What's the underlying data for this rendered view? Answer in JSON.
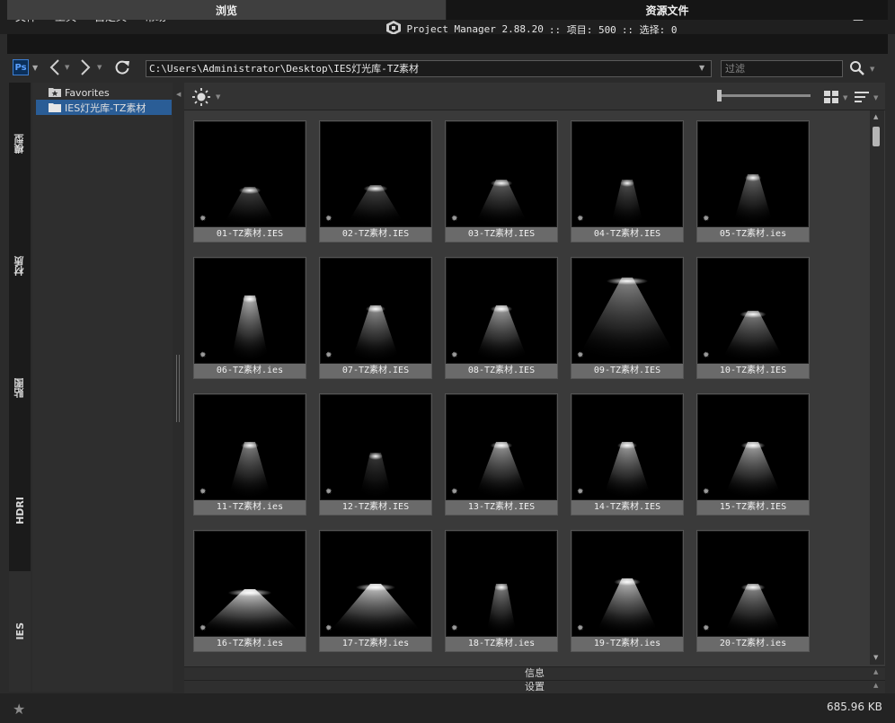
{
  "menu": [
    "文件",
    "工具",
    "自定义",
    "帮助"
  ],
  "title": {
    "app": "Project Manager 2.88.20",
    "items": ":: 项目: 500",
    "selected": ":: 选择: 0"
  },
  "window": {
    "minimize_glyph": "–",
    "maximize_glyph": "□",
    "close_glyph": "✕"
  },
  "tabs": {
    "browse": "浏览",
    "resources": "资源文件"
  },
  "toolbar": {
    "app_badge": "Ps",
    "path": "C:\\Users\\Administrator\\Desktop\\IES灯光库-TZ素材",
    "filter_placeholder": "过滤"
  },
  "left_tabs": [
    "模型",
    "材质",
    "贴图",
    "HDRI",
    "IES"
  ],
  "tree": {
    "favorites": "Favorites",
    "folder": "IES灯光库-TZ素材"
  },
  "files": [
    "01-TZ素材.IES",
    "02-TZ素材.IES",
    "03-TZ素材.IES",
    "04-TZ素材.IES",
    "05-TZ素材.ies",
    "06-TZ素材.ies",
    "07-TZ素材.IES",
    "08-TZ素材.IES",
    "09-TZ素材.IES",
    "10-TZ素材.IES",
    "11-TZ素材.ies",
    "12-TZ素材.IES",
    "13-TZ素材.IES",
    "14-TZ素材.IES",
    "15-TZ素材.IES",
    "16-TZ素材.ies",
    "17-TZ素材.ies",
    "18-TZ素材.ies",
    "19-TZ素材.ies",
    "20-TZ素材.ies"
  ],
  "panels": {
    "info": "信息",
    "settings": "设置"
  },
  "status": {
    "size": "685.96 KB"
  },
  "colors": {
    "selection": "#2a5d96",
    "accent_ps": "#3d7fd4"
  }
}
